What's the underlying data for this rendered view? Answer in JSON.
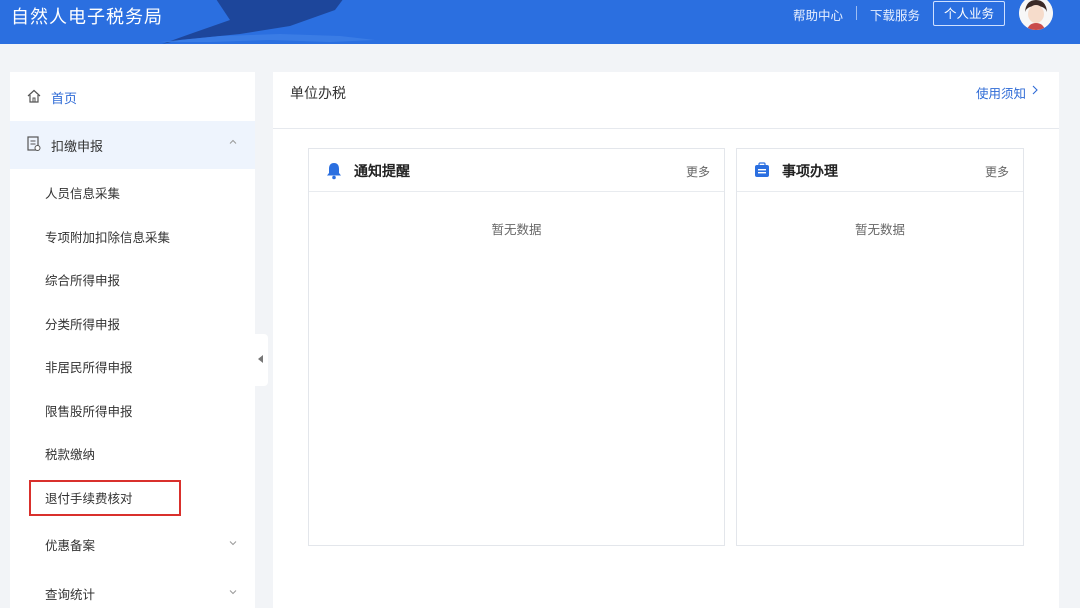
{
  "header": {
    "app_title": "自然人电子税务局",
    "help_center": "帮助中心",
    "download_service": "下载服务",
    "personal_business": "个人业务",
    "brand_color": "#2b6fe0"
  },
  "sidebar": {
    "home": "首页",
    "group": "扣缴申报",
    "items": [
      "人员信息采集",
      "专项附加扣除信息采集",
      "综合所得申报",
      "分类所得申报",
      "非居民所得申报",
      "限售股所得申报",
      "税款缴纳",
      "退付手续费核对",
      "优惠备案",
      "查询统计"
    ],
    "highlighted_item": "退付手续费核对"
  },
  "main": {
    "section_title": "单位办税",
    "usage_notes": "使用须知",
    "panels": [
      {
        "title": "通知提醒",
        "more": "更多",
        "empty": "暂无数据",
        "icon": "bell-icon"
      },
      {
        "title": "事项办理",
        "more": "更多",
        "empty": "暂无数据",
        "icon": "briefcase-icon"
      }
    ]
  }
}
